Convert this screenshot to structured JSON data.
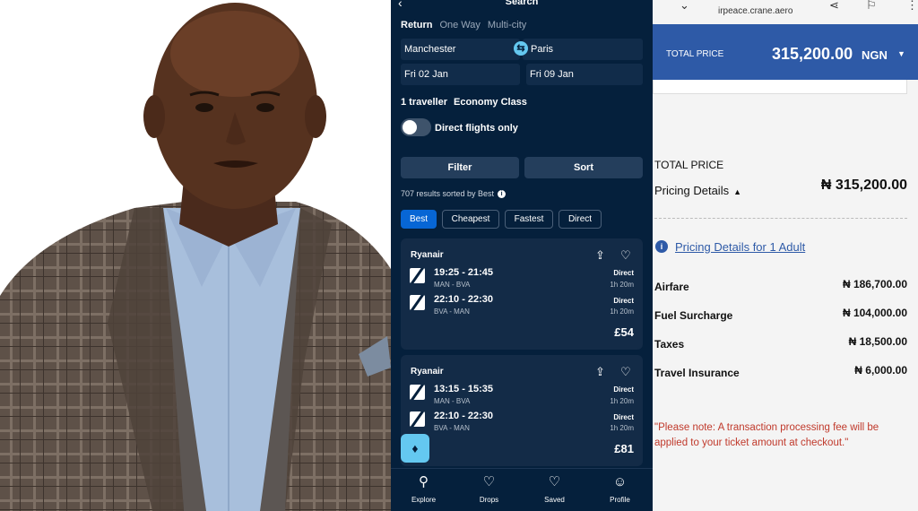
{
  "flight_app": {
    "header_title": "Search",
    "trip_types": [
      "Return",
      "One Way",
      "Multi-city"
    ],
    "from": "Manchester",
    "to": "Paris",
    "depart_date": "Fri 02 Jan",
    "return_date": "Fri 09 Jan",
    "travellers": "1 traveller",
    "cabin": "Economy Class",
    "direct_only_label": "Direct flights only",
    "direct_only_on": false,
    "filter_label": "Filter",
    "sort_label": "Sort",
    "results_text": "707 results sorted by Best",
    "sort_chips": [
      "Best",
      "Cheapest",
      "Fastest",
      "Direct"
    ],
    "cards": [
      {
        "airline": "Ryanair",
        "legs": [
          {
            "time": "19:25 - 21:45",
            "route": "MAN - BVA",
            "stops": "Direct",
            "duration": "1h 20m"
          },
          {
            "time": "22:10 - 22:30",
            "route": "BVA - MAN",
            "stops": "Direct",
            "duration": "1h 20m"
          }
        ],
        "price": "£54"
      },
      {
        "airline": "Ryanair",
        "legs": [
          {
            "time": "13:15 - 15:35",
            "route": "MAN - BVA",
            "stops": "Direct",
            "duration": "1h 20m"
          },
          {
            "time": "22:10 - 22:30",
            "route": "BVA - MAN",
            "stops": "Direct",
            "duration": "1h 20m"
          }
        ],
        "price": "£81"
      }
    ],
    "nav": [
      "Explore",
      "Drops",
      "Saved",
      "Profile"
    ]
  },
  "airline_site": {
    "url": "irpeace.crane.aero",
    "total_bar_label": "TOTAL PRICE",
    "total_bar_amount": "315,200.00",
    "total_bar_currency": "NGN",
    "total_heading": "TOTAL PRICE",
    "pricing_details_label": "Pricing Details",
    "total_amount": "₦ 315,200.00",
    "details_link": "Pricing Details for 1 Adult",
    "rows": [
      {
        "label": "Airfare",
        "value": "₦ 186,700.00"
      },
      {
        "label": "Fuel Surcharge",
        "value": "₦ 104,000.00"
      },
      {
        "label": "Taxes",
        "value": "₦ 18,500.00"
      },
      {
        "label": "Travel Insurance",
        "value": "₦ 6,000.00"
      }
    ],
    "note": "\"Please note: A transaction processing fee will be applied to your ticket amount at checkout.\""
  },
  "colors": {
    "app_bg": "#05203c",
    "card_bg": "#132b47",
    "accent_blue": "#0766d5",
    "cyan": "#64c8f0",
    "airpeace_blue": "#2e5aa7",
    "note_red": "#c0392b"
  },
  "icons": {
    "back": "back-arrow-icon",
    "swap": "swap-icon",
    "share": "share-icon",
    "favorite": "heart-icon",
    "alert": "bell-icon",
    "nav": [
      "search-icon",
      "drops-icon",
      "heart-icon",
      "profile-icon"
    ],
    "info": "info-icon"
  }
}
